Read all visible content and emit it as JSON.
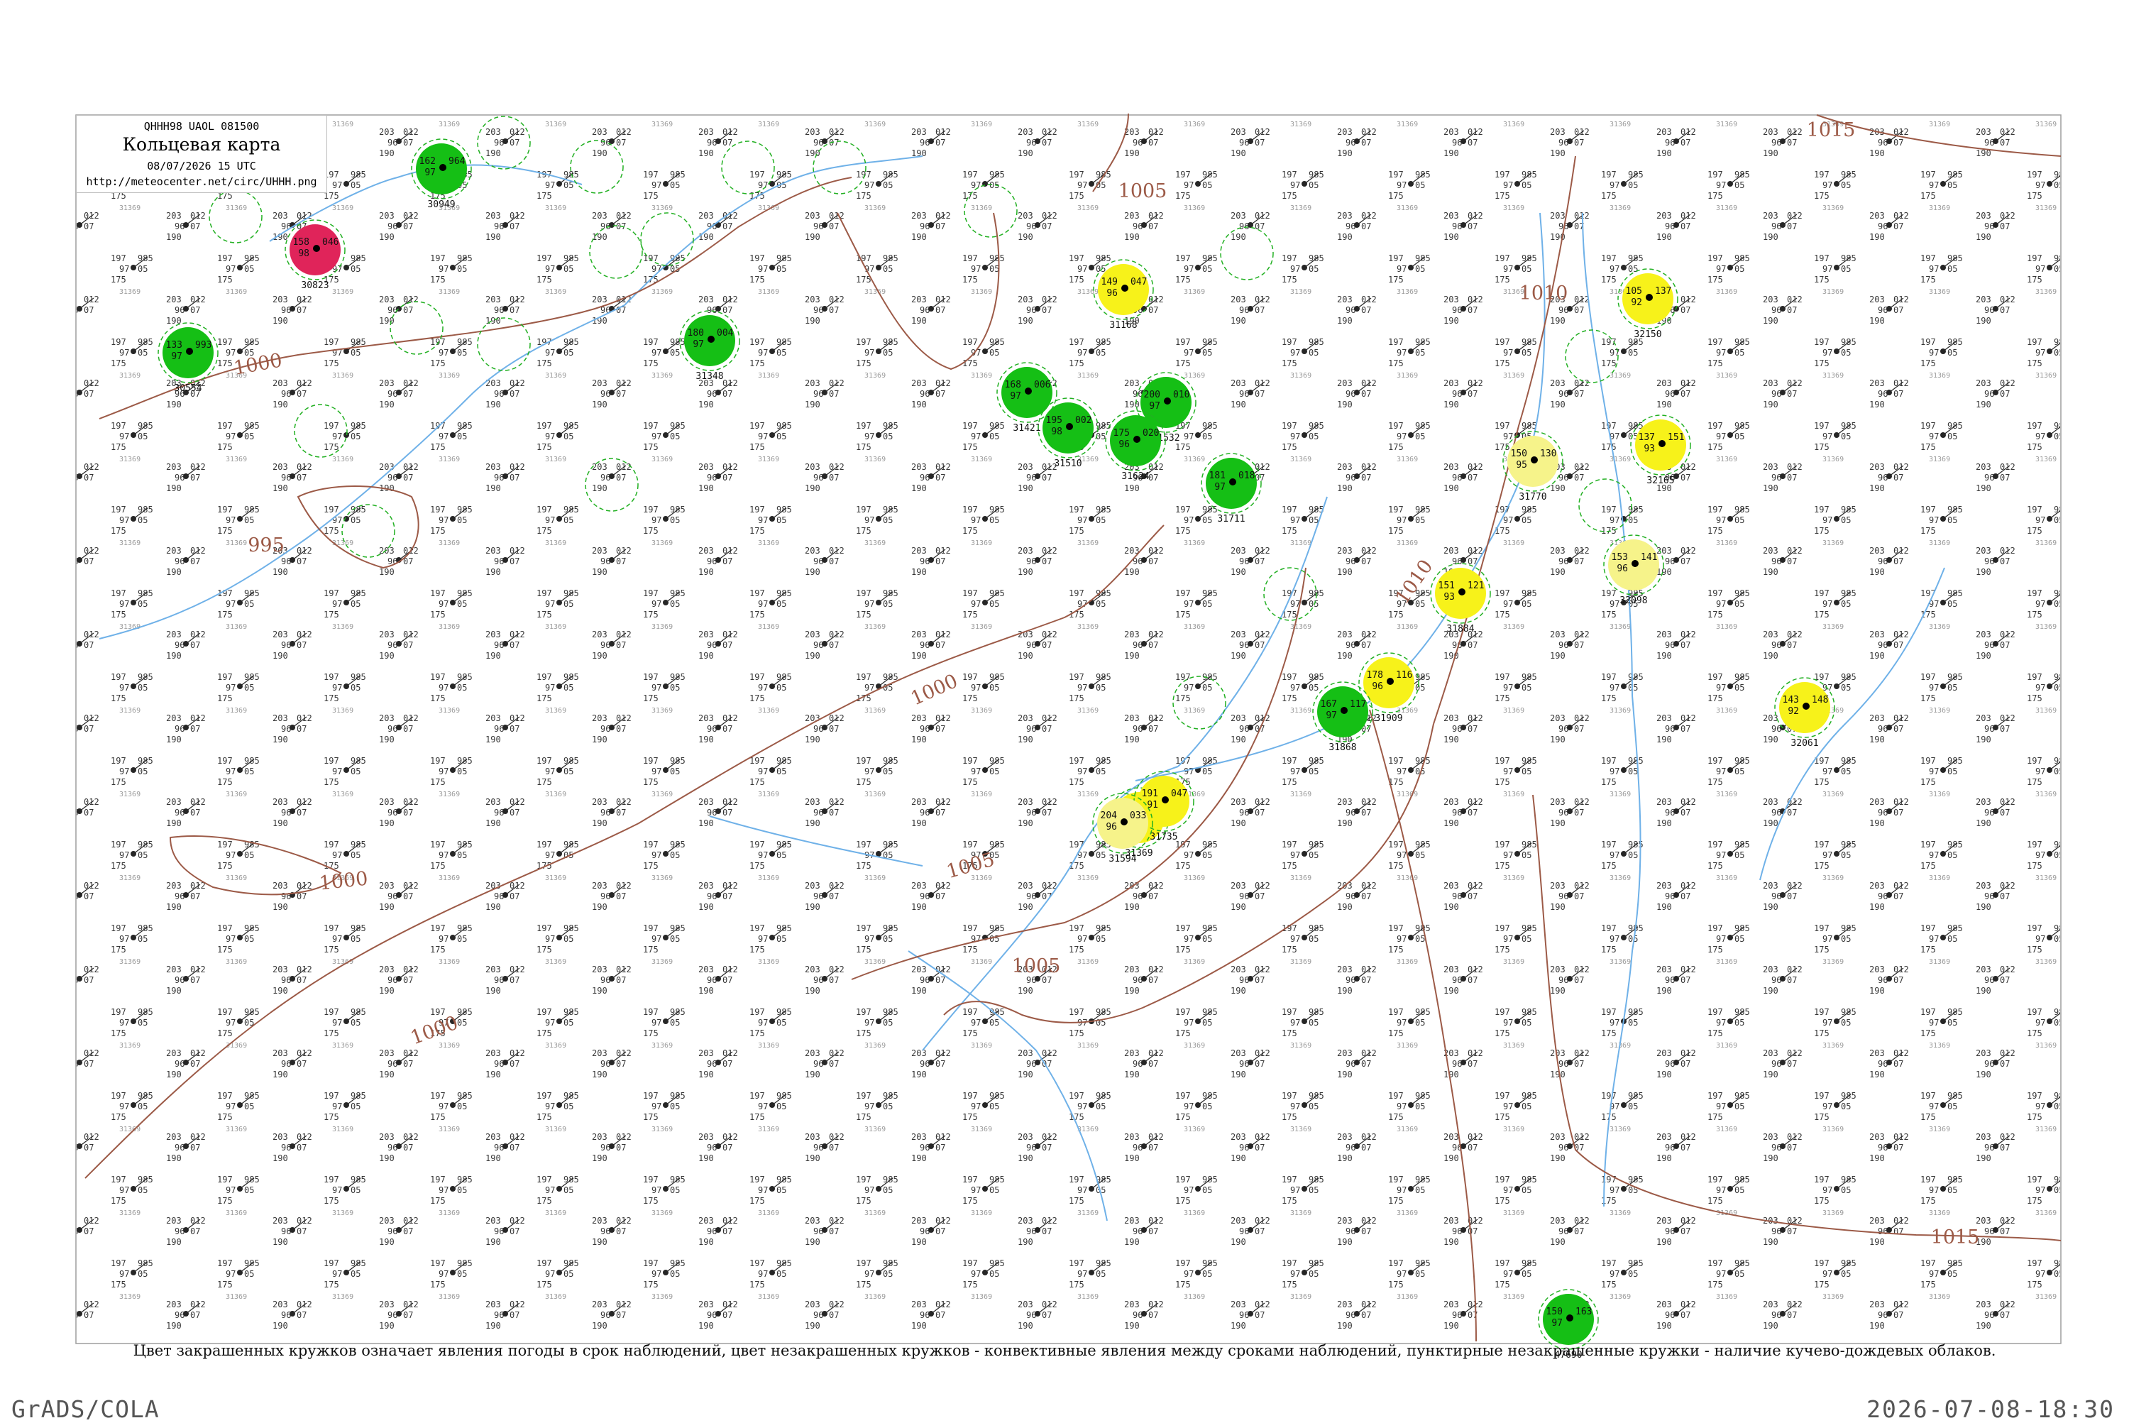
{
  "header": {
    "codes": "QHHH98  UAOL  081500",
    "title": "Кольцевая карта",
    "datetime": "08/07/2026 15 UTC",
    "url": "http://meteocenter.net/circ/UHHH.png"
  },
  "footnote": "Цвет закрашенных кружков означает явления погоды в срок наблюдений, цвет незакрашенных кружков - конвективные явления между сроками наблюдений, пунктирные незакрашенные кружки - наличие кучево-дождевых облаков.",
  "footer": {
    "brand": "GrADS/COLA",
    "timestamp": "2026-07-08-18:30"
  },
  "map": {
    "isobars": [
      "1000",
      "995",
      "1000",
      "1000",
      "1000",
      "1005",
      "1005",
      "1005",
      "1010",
      "1010",
      "1015",
      "1015"
    ],
    "colors": {
      "isobar": "#9c5a47",
      "river": "#6fb1e8",
      "frame": "#9e9e9e",
      "station_green": "#15bf15",
      "station_yellow": "#f7f21a",
      "station_pale": "#f6f38a",
      "station_red": "#e0245a",
      "dashed_ring": "#22b022"
    },
    "stations": [
      {
        "id": "31168",
        "t": "149",
        "td": "96",
        "p": "047",
        "color": "yellow"
      },
      {
        "id": "31369",
        "t": "195",
        "td": "96",
        "p": "048",
        "color": "yellow"
      },
      {
        "id": "31735",
        "t": "191",
        "td": "91",
        "p": "047",
        "color": "yellow"
      },
      {
        "id": "31594",
        "t": "204",
        "td": "96",
        "p": "033",
        "color": "pale"
      },
      {
        "id": "32061",
        "t": "143",
        "td": "92",
        "p": "148",
        "color": "yellow"
      },
      {
        "id": "31884",
        "t": "151",
        "td": "93",
        "p": "121",
        "color": "yellow"
      },
      {
        "id": "31909",
        "t": "178",
        "td": "96",
        "p": "116",
        "color": "yellow"
      },
      {
        "id": "32165",
        "t": "137",
        "td": "93",
        "p": "151",
        "color": "yellow"
      },
      {
        "id": "31770",
        "t": "150",
        "td": "95",
        "p": "130",
        "color": "pale"
      },
      {
        "id": "32098",
        "t": "153",
        "td": "96",
        "p": "141",
        "color": "pale"
      },
      {
        "id": "32150",
        "t": "105",
        "td": "92",
        "p": "137",
        "color": "yellow"
      },
      {
        "id": "30823",
        "t": "158",
        "td": "98",
        "p": "046",
        "color": "red"
      },
      {
        "id": "30554",
        "t": "133",
        "td": "97",
        "p": "993",
        "color": "green"
      },
      {
        "id": "30949",
        "t": "162",
        "td": "97",
        "p": "964",
        "color": "green"
      },
      {
        "id": "31348",
        "t": "180",
        "td": "97",
        "p": "004",
        "color": "green"
      },
      {
        "id": "31421",
        "t": "168",
        "td": "97",
        "p": "006",
        "color": "green"
      },
      {
        "id": "31510",
        "t": "195",
        "td": "98",
        "p": "002",
        "color": "green"
      },
      {
        "id": "31532",
        "t": "200",
        "td": "97",
        "p": "010",
        "color": "green"
      },
      {
        "id": "31624",
        "t": "175",
        "td": "96",
        "p": "020",
        "color": "green"
      },
      {
        "id": "31711",
        "t": "181",
        "td": "97",
        "p": "018",
        "color": "green"
      },
      {
        "id": "31868",
        "t": "167",
        "td": "97",
        "p": "117",
        "color": "green"
      },
      {
        "id": "47690",
        "t": "150",
        "td": "97",
        "p": "163",
        "color": "green"
      }
    ]
  }
}
